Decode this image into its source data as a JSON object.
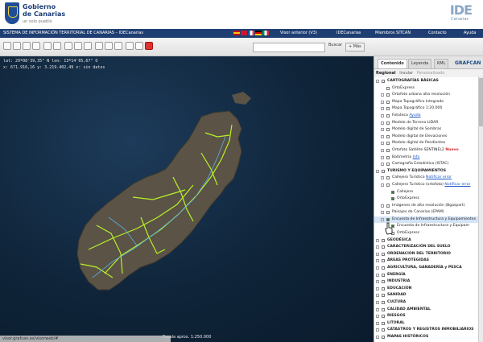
{
  "header": {
    "logo_line1": "Gobierno",
    "logo_line2": "de Canarias",
    "logo_line3": "un solo pueblo",
    "ide_logo": "IDE",
    "ide_sub": "Canarias"
  },
  "menubar": {
    "title": "SISTEMA DE INFORMACIÓN TERRITORIAL DE CANARIAS – IDECanarias",
    "items": [
      "Visor anterior (V3)",
      "IDECanarias",
      "Miembros SITCAN",
      "Contacto",
      "Ayuda"
    ]
  },
  "toolbar": {
    "search_placeholder": "",
    "search_label": "Buscar",
    "more_label": "+ Más"
  },
  "map": {
    "coords_line1": "lat: 29º08'39,35\" N  lon: 13º14'05,67\" O",
    "coords_line2": "x: 671.916,16  y: 3.219.402,49  z: sin datos",
    "scale": "Escala aprox. 1:250.000",
    "status_url": "visor.grafcan.es/visorweb/#"
  },
  "panel": {
    "tabs": [
      "Contenido",
      "Leyenda",
      "KML"
    ],
    "brand": "GRAFCAN",
    "subtabs": [
      "Regional",
      "Insular",
      "Personalizado"
    ],
    "tree": [
      {
        "level": 0,
        "type": "cat",
        "expand": "-",
        "checked": false,
        "label": "CARTOGRAFÍAS BÁSICAS"
      },
      {
        "level": 1,
        "type": "item",
        "expand": "",
        "checked": false,
        "label": "OrtoExpress"
      },
      {
        "level": 1,
        "type": "item",
        "expand": "+",
        "checked": false,
        "label": "Ortofoto urbana alta resolución"
      },
      {
        "level": 1,
        "type": "item",
        "expand": "+",
        "checked": false,
        "label": "Mapa Topográfico Integrado"
      },
      {
        "level": 1,
        "type": "item",
        "expand": "+",
        "checked": false,
        "label": "Mapa Topográfico 1:20.000"
      },
      {
        "level": 1,
        "type": "item",
        "expand": "+",
        "checked": false,
        "label": "Fototeca",
        "link": "Ayuda"
      },
      {
        "level": 1,
        "type": "item",
        "expand": "+",
        "checked": false,
        "label": "Modelo de Terreno LIDAR"
      },
      {
        "level": 1,
        "type": "item",
        "expand": "+",
        "checked": false,
        "label": "Modelo digital de Sombras"
      },
      {
        "level": 1,
        "type": "item",
        "expand": "+",
        "checked": false,
        "label": "Modelo digital de Elevaciones"
      },
      {
        "level": 1,
        "type": "item",
        "expand": "+",
        "checked": false,
        "label": "Modelo digital de Pendientes"
      },
      {
        "level": 1,
        "type": "item",
        "expand": "+",
        "checked": false,
        "label": "Ortofoto Satélite SENTINEL2",
        "badge": "Nuevo"
      },
      {
        "level": 1,
        "type": "item",
        "expand": "+",
        "checked": false,
        "label": "Batimetría",
        "link": "Info"
      },
      {
        "level": 1,
        "type": "item",
        "expand": "+",
        "checked": false,
        "label": "Cartografía Estadística (ISTAC)"
      },
      {
        "level": 0,
        "type": "cat",
        "expand": "-",
        "checked": false,
        "label": "TURISMO Y EQUIPAMIENTOS"
      },
      {
        "level": 1,
        "type": "item",
        "expand": "+",
        "checked": false,
        "label": "Callejero Turístico",
        "link": "Notificar error"
      },
      {
        "level": 1,
        "type": "item",
        "expand": "-",
        "checked": false,
        "label": "Callejero Turístico (ortofoto)",
        "link": "Notificar error"
      },
      {
        "level": 2,
        "type": "item",
        "expand": "",
        "checked": true,
        "label": "Callejero"
      },
      {
        "level": 2,
        "type": "item",
        "expand": "",
        "checked": true,
        "label": "OrtoExpress"
      },
      {
        "level": 1,
        "type": "item",
        "expand": "+",
        "checked": false,
        "label": "Imágenes de alta resolución (Bgasport)"
      },
      {
        "level": 1,
        "type": "item",
        "expand": "+",
        "checked": false,
        "label": "Paisajes de Canarias (EPAM)"
      },
      {
        "level": 1,
        "type": "item",
        "expand": "-",
        "checked": true,
        "label": "Encuesta de Infraestructura y Equipamientos",
        "highlight": true
      },
      {
        "level": 2,
        "type": "item",
        "expand": "",
        "checked": true,
        "label": "Encuesta de Infraestructura y Equipam"
      },
      {
        "level": 2,
        "type": "item",
        "expand": "",
        "checked": false,
        "label": "OrtoExpress"
      },
      {
        "level": 0,
        "type": "cat",
        "expand": "+",
        "checked": false,
        "label": "GEODÉSICA"
      },
      {
        "level": 0,
        "type": "cat",
        "expand": "+",
        "checked": false,
        "label": "CARACTERIZACIÓN DEL SUELO"
      },
      {
        "level": 0,
        "type": "cat",
        "expand": "+",
        "checked": false,
        "label": "ORDENACIÓN DEL TERRITORIO"
      },
      {
        "level": 0,
        "type": "cat",
        "expand": "+",
        "checked": false,
        "label": "ÁREAS PROTEGIDAS"
      },
      {
        "level": 0,
        "type": "cat",
        "expand": "+",
        "checked": false,
        "label": "AGRICULTURA, GANADERÍA y PESCA"
      },
      {
        "level": 0,
        "type": "cat",
        "expand": "+",
        "checked": false,
        "label": "ENERGÍA"
      },
      {
        "level": 0,
        "type": "cat",
        "expand": "+",
        "checked": false,
        "label": "INDUSTRIA"
      },
      {
        "level": 0,
        "type": "cat",
        "expand": "+",
        "checked": false,
        "label": "EDUCACIÓN"
      },
      {
        "level": 0,
        "type": "cat",
        "expand": "+",
        "checked": false,
        "label": "SANIDAD"
      },
      {
        "level": 0,
        "type": "cat",
        "expand": "+",
        "checked": false,
        "label": "CULTURA"
      },
      {
        "level": 0,
        "type": "cat",
        "expand": "+",
        "checked": false,
        "label": "CALIDAD AMBIENTAL"
      },
      {
        "level": 0,
        "type": "cat",
        "expand": "+",
        "checked": false,
        "label": "RIESGOS"
      },
      {
        "level": 0,
        "type": "cat",
        "expand": "+",
        "checked": false,
        "label": "LITORAL"
      },
      {
        "level": 0,
        "type": "cat",
        "expand": "+",
        "checked": false,
        "label": "CATASTROS Y REGISTROS INMOBILIARIOS"
      },
      {
        "level": 0,
        "type": "cat",
        "expand": "+",
        "checked": false,
        "label": "MAPAS HISTÓRICOS"
      }
    ]
  },
  "colors": {
    "accent": "#1f3f73",
    "roads": "#b9f227",
    "land": "#5a5346",
    "sea": "#0f2439"
  }
}
